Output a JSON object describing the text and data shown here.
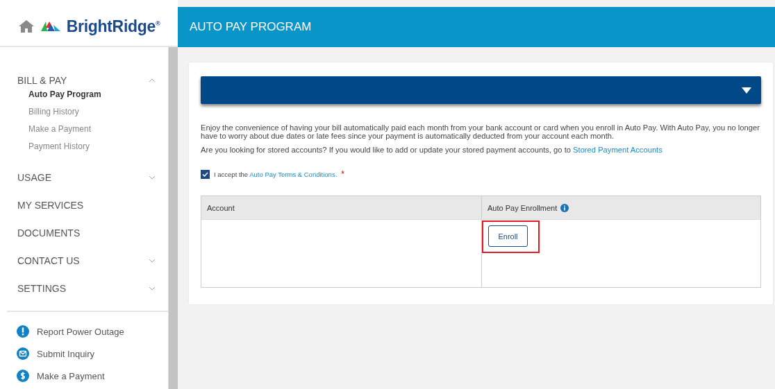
{
  "brand": {
    "name": "BrightRidge$^{®}$"
  },
  "header": {
    "title": "AUTO PAY PROGRAM"
  },
  "sidebar": {
    "sections": [
      {
        "kind": "group",
        "label": "BILL & PAY",
        "expanded": true,
        "children": [
          {
            "label": "Auto Pay Program",
            "selected": true
          },
          {
            "label": "Billing History",
            "selected": false
          },
          {
            "label": "Make a Payment",
            "selected": false
          },
          {
            "label": "Payment History",
            "selected": false
          }
        ]
      },
      {
        "kind": "group",
        "label": "USAGE",
        "expanded": false
      },
      {
        "kind": "link",
        "label": "MY SERVICES"
      },
      {
        "kind": "link",
        "label": "DOCUMENTS"
      },
      {
        "kind": "group",
        "label": "CONTACT US",
        "expanded": false
      },
      {
        "kind": "group",
        "label": "SETTINGS",
        "expanded": false
      }
    ],
    "quick_links": [
      {
        "kind": "alert",
        "label": "Report Power Outage"
      },
      {
        "kind": "mail",
        "label": "Submit Inquiry"
      },
      {
        "kind": "dollar",
        "label": "Make a Payment"
      }
    ]
  },
  "panel": {
    "expanded": false,
    "intro": "Enjoy the convenience of having your bill automatically paid each month from your bank account or card when you enroll in Auto Pay. With Auto Pay, you no longer have to worry about due dates or late fees since your payment is automatically deducted from your account each month.",
    "stored_text": "Are you looking for stored accounts? If you would like to add or update your stored payment accounts, go to",
    "stored_link": "Stored Payment Accounts",
    "accept": {
      "checked": true,
      "text": "I accept the",
      "link": "Auto Pay Terms & Conditions.",
      "required_mark": "*"
    },
    "table": {
      "columns": [
        "Account",
        "Auto Pay Enrollment"
      ],
      "enroll": {
        "label": "Enroll",
        "highlighted": true
      }
    }
  }
}
